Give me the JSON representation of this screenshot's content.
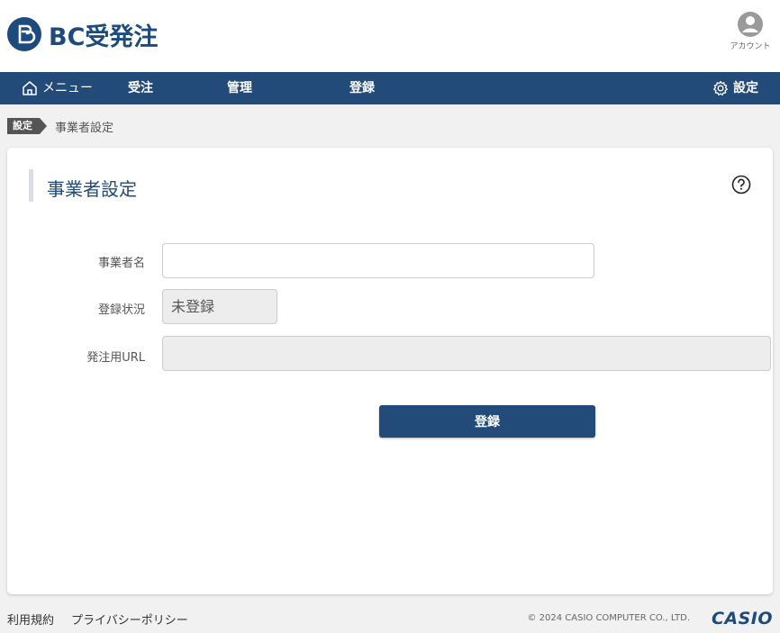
{
  "header": {
    "logo_text": "BC受発注",
    "account_label": "アカウント"
  },
  "nav": {
    "menu": "メニュー",
    "order": "受注",
    "manage": "管理",
    "register": "登録",
    "settings": "設定"
  },
  "breadcrumb": {
    "tag": "設定",
    "current": "事業者設定"
  },
  "form": {
    "title": "事業者設定",
    "name_label": "事業者名",
    "name_value": "",
    "status_label": "登録状況",
    "status_value": "未登録",
    "url_label": "発注用URL",
    "url_value": "",
    "submit_label": "登録"
  },
  "footer": {
    "terms": "利用規約",
    "privacy": "プライバシーポリシー",
    "copyright": "© 2024 CASIO COMPUTER CO., LTD.",
    "brand": "CASIO"
  },
  "colors": {
    "primary": "#234b79",
    "background": "#f1f1f1"
  }
}
